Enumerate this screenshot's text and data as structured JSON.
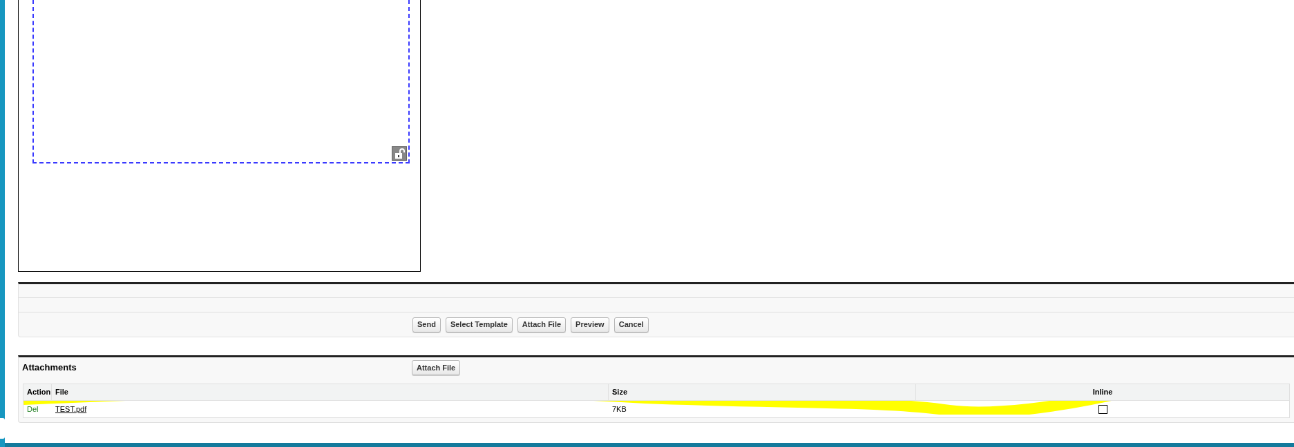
{
  "editor": {
    "locked": false
  },
  "actions": [
    "Send",
    "Select Template",
    "Attach File",
    "Preview",
    "Cancel"
  ],
  "attachments": {
    "title": "Attachments",
    "attach_button": "Attach File",
    "columns": [
      "Action",
      "File",
      "Size",
      "Inline"
    ],
    "rows": [
      {
        "action": "Del",
        "file": "TEST.pdf",
        "size": "7KB",
        "inline": false
      }
    ]
  }
}
